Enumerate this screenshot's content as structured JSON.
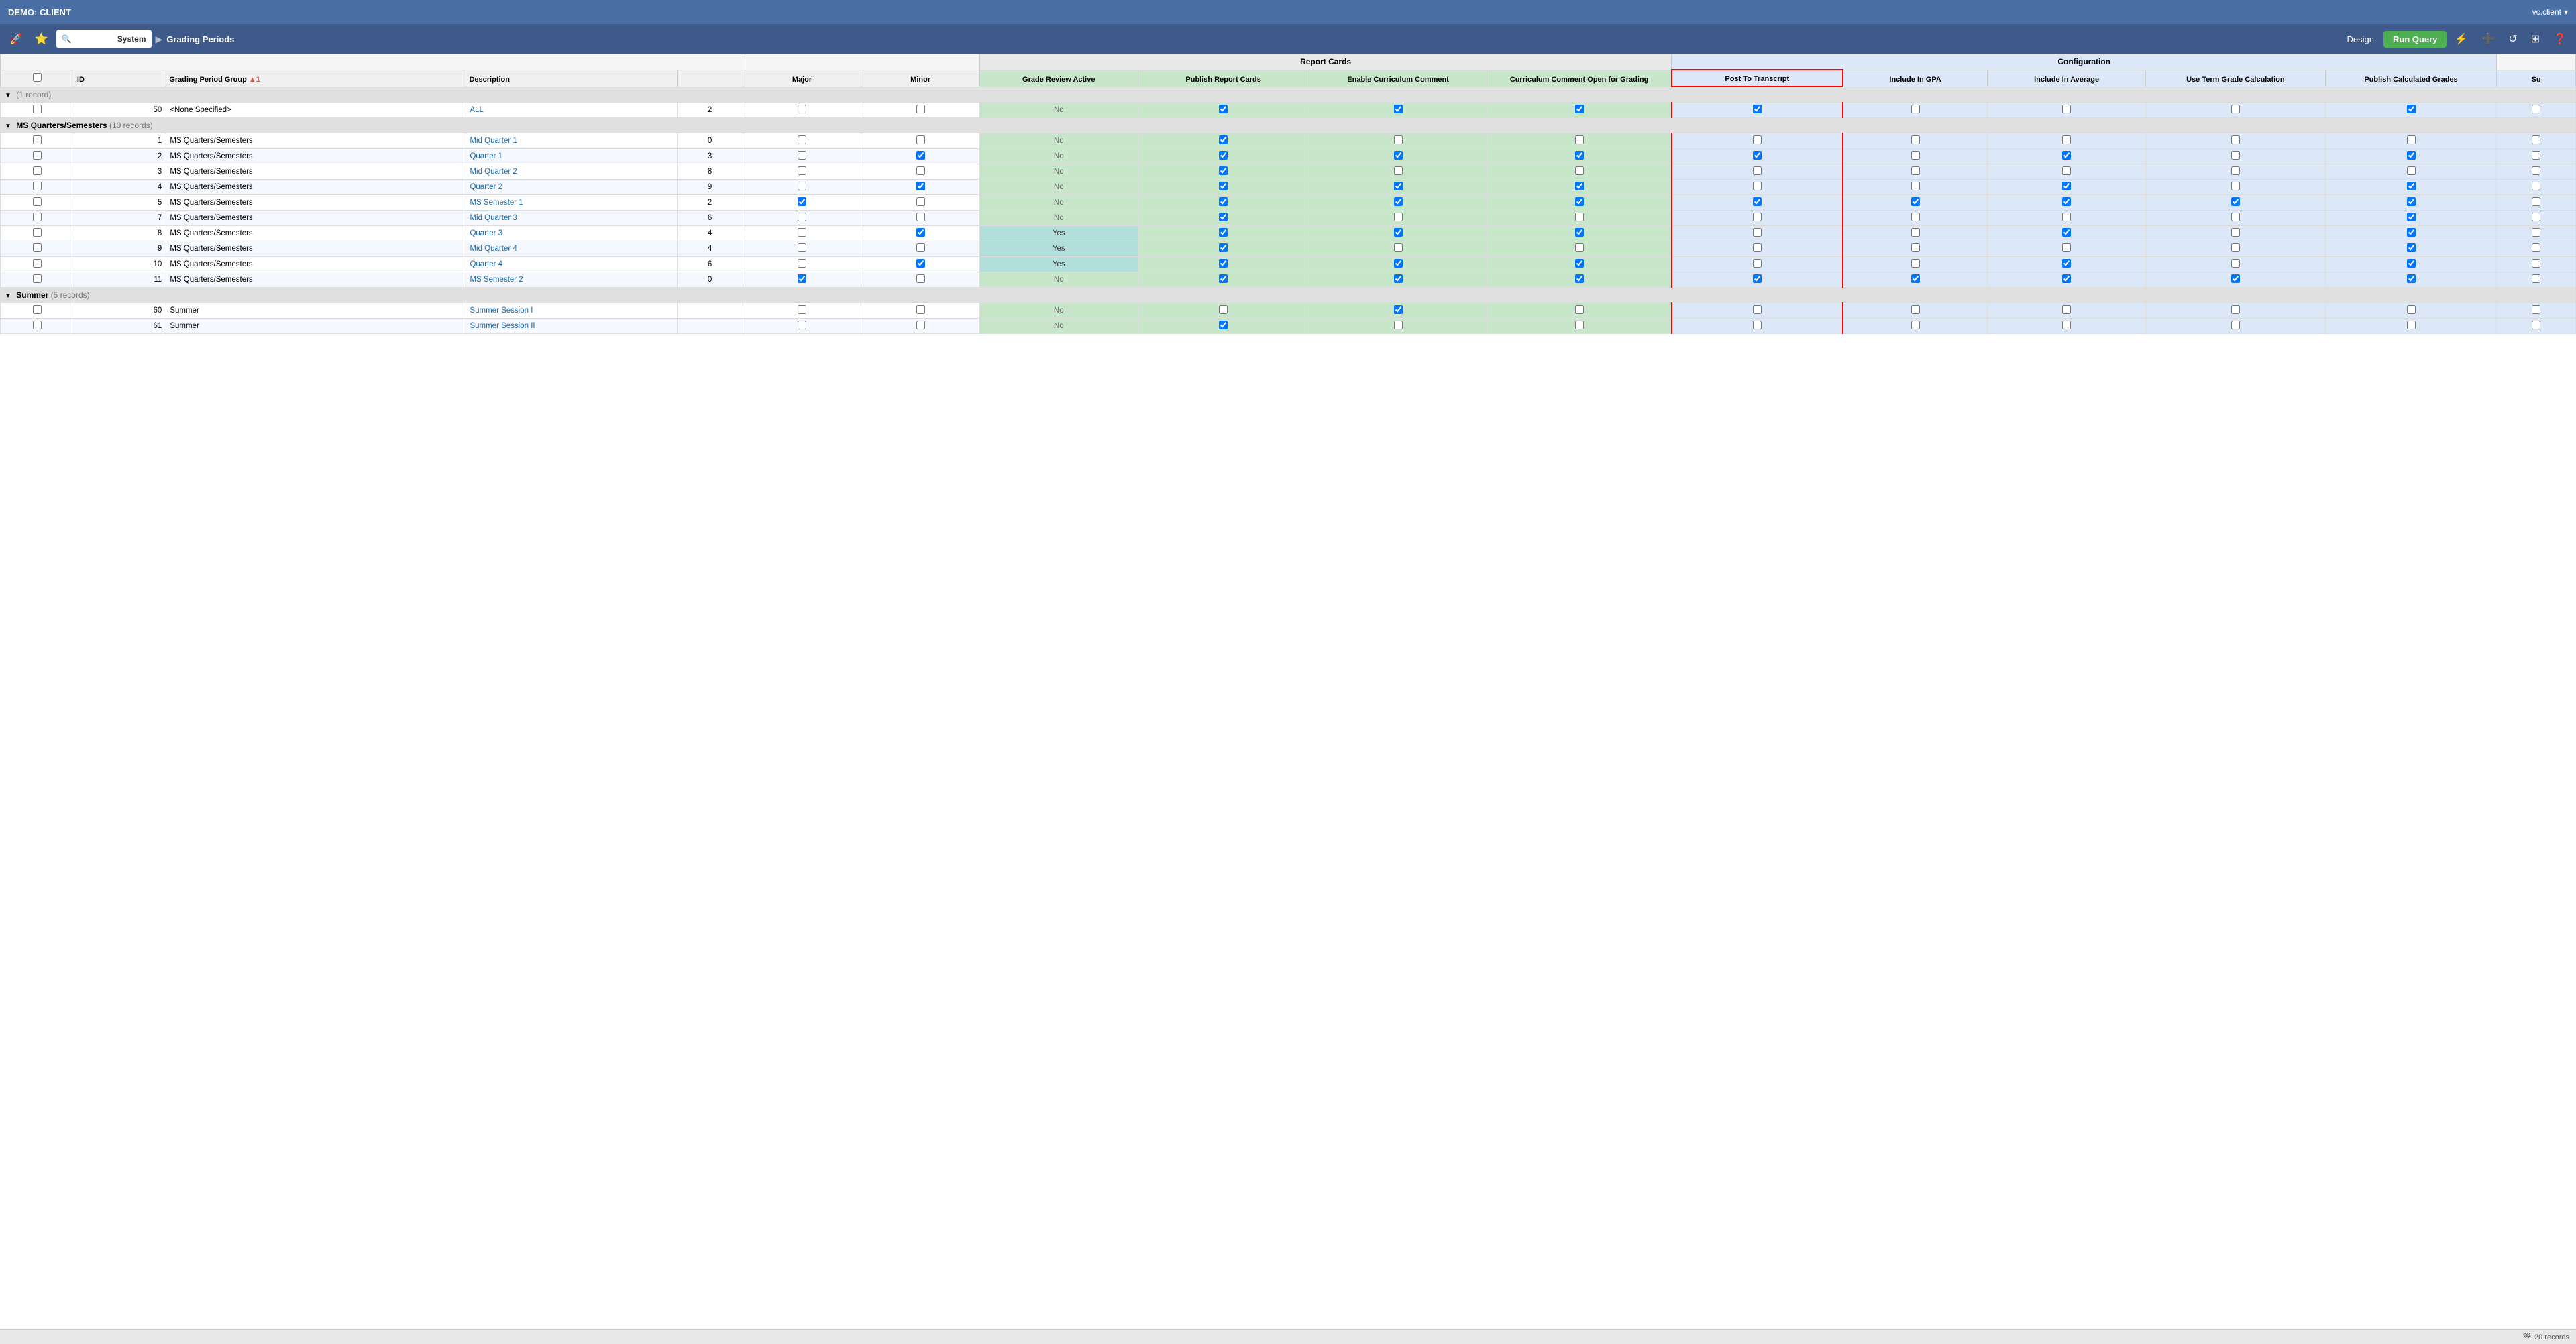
{
  "topbar": {
    "title": "DEMO: CLIENT",
    "user": "vc.client",
    "chevron": "▾"
  },
  "navbar": {
    "system_label": "System",
    "page_label": "Grading Periods",
    "design_label": "Design",
    "run_query_label": "Run Query"
  },
  "table": {
    "group_headers": {
      "report_cards_label": "Report Cards",
      "configuration_label": "Configuration"
    },
    "col_headers": [
      {
        "key": "checkbox",
        "label": ""
      },
      {
        "key": "id",
        "label": "ID"
      },
      {
        "key": "grading_period_group",
        "label": "Grading Period Group"
      },
      {
        "key": "description",
        "label": "Description"
      },
      {
        "key": "sort",
        "label": ""
      },
      {
        "key": "major",
        "label": "Major"
      },
      {
        "key": "minor",
        "label": "Minor"
      },
      {
        "key": "grade_review_active",
        "label": "Grade Review Active"
      },
      {
        "key": "publish_report_cards",
        "label": "Publish Report Cards"
      },
      {
        "key": "enable_curriculum_comment",
        "label": "Enable Curriculum Comment"
      },
      {
        "key": "curriculum_comment_open_for_grading",
        "label": "Curriculum Comment Open for Grading"
      },
      {
        "key": "post_to_transcript",
        "label": "Post To Transcript"
      },
      {
        "key": "include_in_gpa",
        "label": "Include In GPA"
      },
      {
        "key": "include_in_average",
        "label": "Include In Average"
      },
      {
        "key": "use_term_grade_calculation",
        "label": "Use Term Grade Calculation"
      },
      {
        "key": "publish_calculated_grades",
        "label": "Publish Calculated Grades"
      },
      {
        "key": "su",
        "label": "Su"
      }
    ],
    "groups": [
      {
        "name": "<None Specified>",
        "count": "1 record",
        "rows": [
          {
            "id": "50",
            "grading_period_group": "<None Specified>",
            "description": "ALL",
            "description_link": true,
            "sort": "2",
            "major": false,
            "minor": false,
            "grade_review_active": "No",
            "publish_report_cards": true,
            "enable_curriculum_comment": true,
            "curriculum_comment_open_for_grading": true,
            "post_to_transcript": true,
            "include_in_gpa": false,
            "include_in_average": false,
            "use_term_grade_calculation": false,
            "publish_calculated_grades": true,
            "su": false
          }
        ]
      },
      {
        "name": "MS Quarters/Semesters",
        "count": "10 records",
        "rows": [
          {
            "id": "1",
            "grading_period_group": "MS Quarters/Semesters",
            "description": "Mid Quarter 1",
            "description_link": true,
            "sort": "0",
            "major": false,
            "minor": false,
            "grade_review_active": "No",
            "publish_report_cards": true,
            "enable_curriculum_comment": false,
            "curriculum_comment_open_for_grading": false,
            "post_to_transcript": false,
            "include_in_gpa": false,
            "include_in_average": false,
            "use_term_grade_calculation": false,
            "publish_calculated_grades": false,
            "su": false
          },
          {
            "id": "2",
            "grading_period_group": "MS Quarters/Semesters",
            "description": "Quarter 1",
            "description_link": true,
            "sort": "3",
            "major": false,
            "minor": true,
            "grade_review_active": "No",
            "publish_report_cards": true,
            "enable_curriculum_comment": true,
            "curriculum_comment_open_for_grading": true,
            "post_to_transcript": true,
            "include_in_gpa": false,
            "include_in_average": true,
            "use_term_grade_calculation": false,
            "publish_calculated_grades": true,
            "su": false
          },
          {
            "id": "3",
            "grading_period_group": "MS Quarters/Semesters",
            "description": "Mid Quarter 2",
            "description_link": true,
            "sort": "8",
            "major": false,
            "minor": false,
            "grade_review_active": "No",
            "publish_report_cards": true,
            "enable_curriculum_comment": false,
            "curriculum_comment_open_for_grading": false,
            "post_to_transcript": false,
            "include_in_gpa": false,
            "include_in_average": false,
            "use_term_grade_calculation": false,
            "publish_calculated_grades": false,
            "su": false
          },
          {
            "id": "4",
            "grading_period_group": "MS Quarters/Semesters",
            "description": "Quarter 2",
            "description_link": true,
            "sort": "9",
            "major": false,
            "minor": true,
            "grade_review_active": "No",
            "publish_report_cards": true,
            "enable_curriculum_comment": true,
            "curriculum_comment_open_for_grading": true,
            "post_to_transcript": false,
            "include_in_gpa": false,
            "include_in_average": true,
            "use_term_grade_calculation": false,
            "publish_calculated_grades": true,
            "su": false
          },
          {
            "id": "5",
            "grading_period_group": "MS Quarters/Semesters",
            "description": "MS Semester 1",
            "description_link": true,
            "sort": "2",
            "major": true,
            "minor": false,
            "grade_review_active": "No",
            "publish_report_cards": true,
            "enable_curriculum_comment": true,
            "curriculum_comment_open_for_grading": true,
            "post_to_transcript": true,
            "include_in_gpa": true,
            "include_in_average": true,
            "use_term_grade_calculation": true,
            "publish_calculated_grades": true,
            "su": false
          },
          {
            "id": "7",
            "grading_period_group": "MS Quarters/Semesters",
            "description": "Mid Quarter 3",
            "description_link": true,
            "sort": "6",
            "major": false,
            "minor": false,
            "grade_review_active": "No",
            "publish_report_cards": true,
            "enable_curriculum_comment": false,
            "curriculum_comment_open_for_grading": false,
            "post_to_transcript": false,
            "include_in_gpa": false,
            "include_in_average": false,
            "use_term_grade_calculation": false,
            "publish_calculated_grades": true,
            "su": false
          },
          {
            "id": "8",
            "grading_period_group": "MS Quarters/Semesters",
            "description": "Quarter 3",
            "description_link": true,
            "sort": "4",
            "major": false,
            "minor": true,
            "grade_review_active": "Yes",
            "publish_report_cards": true,
            "enable_curriculum_comment": true,
            "curriculum_comment_open_for_grading": true,
            "post_to_transcript": false,
            "include_in_gpa": false,
            "include_in_average": true,
            "use_term_grade_calculation": false,
            "publish_calculated_grades": true,
            "su": false
          },
          {
            "id": "9",
            "grading_period_group": "MS Quarters/Semesters",
            "description": "Mid Quarter 4",
            "description_link": true,
            "sort": "4",
            "major": false,
            "minor": false,
            "grade_review_active": "Yes",
            "publish_report_cards": true,
            "enable_curriculum_comment": false,
            "curriculum_comment_open_for_grading": false,
            "post_to_transcript": false,
            "include_in_gpa": false,
            "include_in_average": false,
            "use_term_grade_calculation": false,
            "publish_calculated_grades": true,
            "su": false
          },
          {
            "id": "10",
            "grading_period_group": "MS Quarters/Semesters",
            "description": "Quarter 4",
            "description_link": true,
            "sort": "6",
            "major": false,
            "minor": true,
            "grade_review_active": "Yes",
            "publish_report_cards": true,
            "enable_curriculum_comment": true,
            "curriculum_comment_open_for_grading": true,
            "post_to_transcript": false,
            "include_in_gpa": false,
            "include_in_average": true,
            "use_term_grade_calculation": false,
            "publish_calculated_grades": true,
            "su": false
          },
          {
            "id": "11",
            "grading_period_group": "MS Quarters/Semesters",
            "description": "MS Semester 2",
            "description_link": true,
            "sort": "0",
            "major": true,
            "minor": false,
            "grade_review_active": "No",
            "publish_report_cards": true,
            "enable_curriculum_comment": true,
            "curriculum_comment_open_for_grading": true,
            "post_to_transcript": true,
            "include_in_gpa": true,
            "include_in_average": true,
            "use_term_grade_calculation": true,
            "publish_calculated_grades": true,
            "su": false
          }
        ]
      },
      {
        "name": "Summer",
        "count": "5 records",
        "rows": [
          {
            "id": "60",
            "grading_period_group": "Summer",
            "description": "Summer Session I",
            "description_link": true,
            "sort": "",
            "major": false,
            "minor": false,
            "grade_review_active": "No",
            "publish_report_cards": false,
            "enable_curriculum_comment": true,
            "curriculum_comment_open_for_grading": false,
            "post_to_transcript": false,
            "include_in_gpa": false,
            "include_in_average": false,
            "use_term_grade_calculation": false,
            "publish_calculated_grades": false,
            "su": false
          },
          {
            "id": "61",
            "grading_period_group": "Summer",
            "description": "Summer Session II",
            "description_link": true,
            "sort": "",
            "major": false,
            "minor": false,
            "grade_review_active": "No",
            "publish_report_cards": true,
            "enable_curriculum_comment": false,
            "curriculum_comment_open_for_grading": false,
            "post_to_transcript": false,
            "include_in_gpa": false,
            "include_in_average": false,
            "use_term_grade_calculation": false,
            "publish_calculated_grades": false,
            "su": false
          }
        ]
      }
    ]
  },
  "statusbar": {
    "records_label": "20 records"
  }
}
